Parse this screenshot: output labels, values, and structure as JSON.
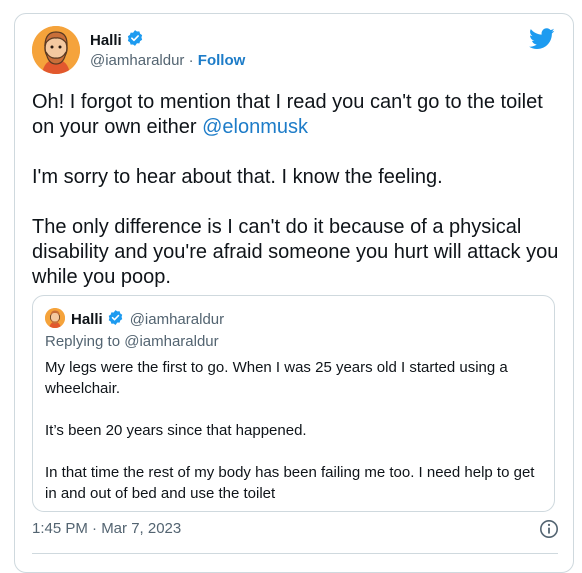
{
  "tweet": {
    "author_name": "Halli",
    "handle": "@iamharaldur",
    "separator": "·",
    "follow_label": "Follow",
    "text_part1": "Oh! I forgot to mention that I read you can't go to the toilet on your own either ",
    "mention": "@elonmusk",
    "text_part2": "\n\nI'm sorry to hear about that. I know the feeling.\n\nThe only difference is I can't do it because of a physical disability and you're afraid someone you hurt will attack you while you poop.",
    "timestamp": "1:45 PM · Mar 7, 2023"
  },
  "quote": {
    "author_name": "Halli",
    "handle": "@iamharaldur",
    "replying_to": "Replying to @iamharaldur",
    "text": "My legs were the first to go. When I was 25 years old I started using a wheelchair.\n\nIt’s been 20 years since that happened.\n\nIn that time the rest of my body has been failing me too. I need help to get in and out of bed and use the toilet"
  },
  "icons": {
    "verified": "verified-badge-icon",
    "brand": "twitter-bird-icon",
    "info": "info-icon"
  },
  "colors": {
    "link": "#1d7cc8",
    "verified": "#1d9bf0",
    "muted": "#536471",
    "border": "#cfd9de"
  }
}
